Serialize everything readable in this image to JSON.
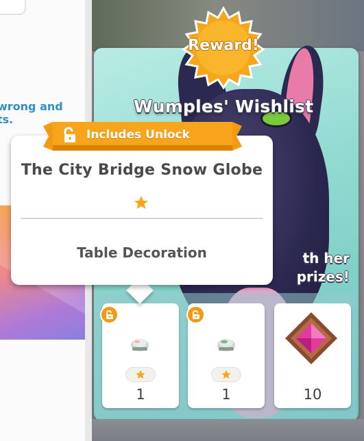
{
  "left_panel": {
    "text_line1": "wrong and",
    "text_line2": "ts."
  },
  "reward": {
    "label": "Reward!",
    "color": "#f7a51c"
  },
  "wishlist": {
    "title": "Wumples' Wishlist",
    "desc_line1": "th her",
    "desc_line2": "prizes!"
  },
  "tooltip": {
    "ribbon_label": "Includes Unlock",
    "ribbon_icon": "unlock-icon",
    "item_name": "The City Bridge Snow Globe",
    "rarity_stars": 1,
    "category": "Table Decoration",
    "accent": "#f39a12"
  },
  "prizes": [
    {
      "icon": "snow-globe-thumb",
      "locked_icon": "unlock-icon",
      "stars": 1,
      "quantity": "1"
    },
    {
      "icon": "snow-globe-thumb-green",
      "locked_icon": "unlock-icon",
      "stars": 1,
      "quantity": "1"
    },
    {
      "icon": "pink-gem-icon",
      "quantity": "10"
    }
  ]
}
